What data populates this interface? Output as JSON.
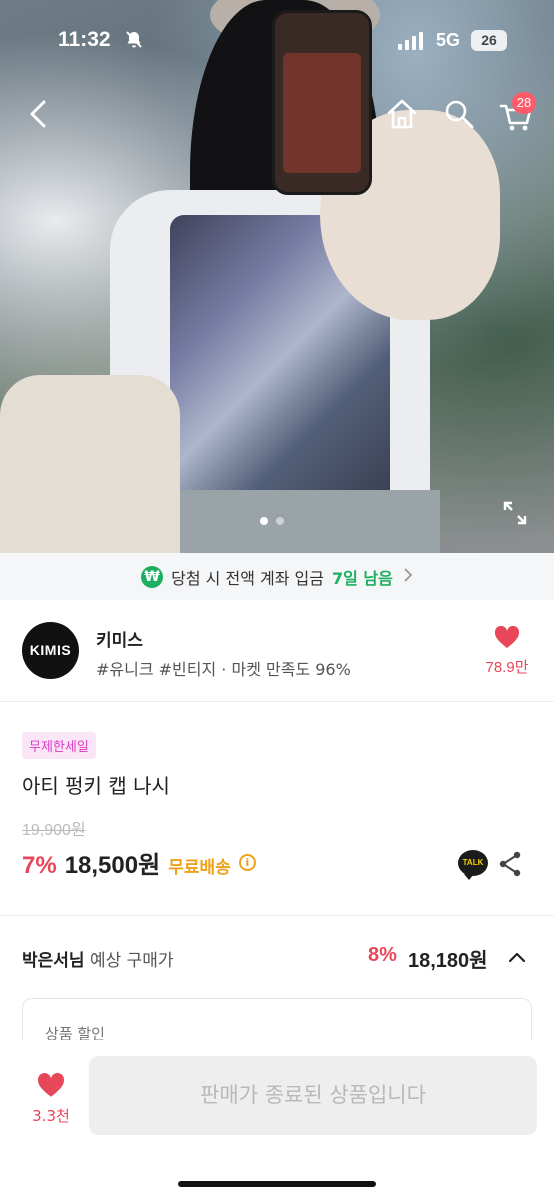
{
  "status_bar": {
    "time": "11:32",
    "network": "5G",
    "battery": "26"
  },
  "nav": {
    "cart_count": "28"
  },
  "gallery": {
    "page_count": 2,
    "current_page": 1
  },
  "promo": {
    "text_before": "당첨 시 전액 계좌 입금",
    "highlight": "7일 남음"
  },
  "seller": {
    "logo_text": "KIMIS",
    "name": "키미스",
    "tags": "#유니크 #빈티지 · 마켓 만족도 96%",
    "likes": "78.9만"
  },
  "product": {
    "badge": "무제한세일",
    "title": "아티 펑키 캡 나시",
    "original_price": "19,900원",
    "discount_rate": "7%",
    "price": "18,500원",
    "shipping": "무료배송",
    "talk_label": "TALK"
  },
  "expected": {
    "user": "박은서님",
    "label": "예상 구매가",
    "rate": "8%",
    "price": "18,180원"
  },
  "discount_box": {
    "title": "상품 할인"
  },
  "bottom_bar": {
    "wish_count": "3.3천",
    "cta": "판매가 종료된 상품입니다"
  },
  "colors": {
    "accent_red": "#e8475a",
    "shipping_orange": "#f0a11a",
    "promo_green": "#1fae61",
    "badge_pink": "#d93cc4"
  }
}
